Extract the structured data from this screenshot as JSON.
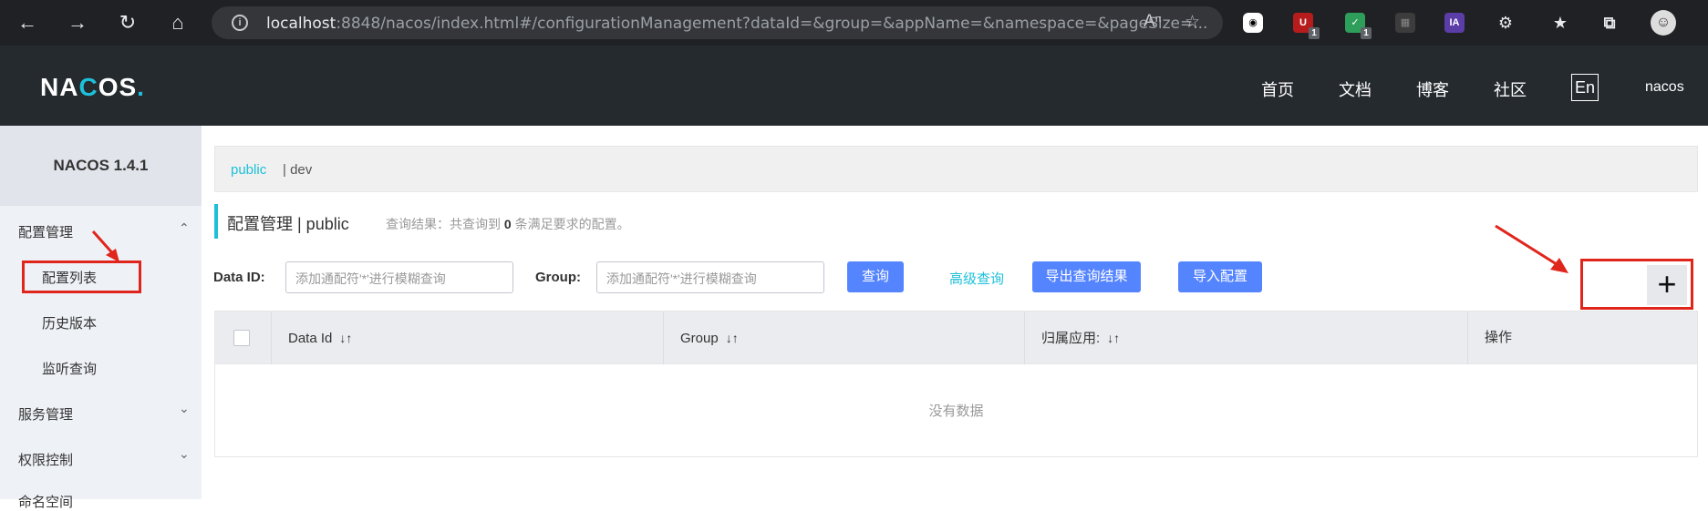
{
  "browser": {
    "url_host": "localhost",
    "url_rest": ":8848/nacos/index.html#/configurationManagement?dataId=&group=&appName=&namespace=&pageSize=...",
    "ext_labels": [
      "1",
      "1",
      "IA"
    ]
  },
  "header": {
    "logo_prefix": "NA",
    "logo_accent": "C",
    "logo_suffix": "OS",
    "logo_dot": ".",
    "nav": [
      "首页",
      "文档",
      "博客",
      "社区"
    ],
    "lang": "En",
    "user": "nacos"
  },
  "sidebar": {
    "version": "NACOS 1.4.1",
    "groups": [
      {
        "label": "配置管理",
        "items": [
          "配置列表",
          "历史版本",
          "监听查询"
        ]
      },
      {
        "label": "服务管理"
      },
      {
        "label": "权限控制"
      },
      {
        "label": "命名空间"
      }
    ]
  },
  "namespaces": {
    "active": "public",
    "other": "| dev"
  },
  "main": {
    "title": "配置管理  |  public",
    "query_prefix": "查询结果：共查询到",
    "query_count": "0",
    "query_suffix": "条满足要求的配置。"
  },
  "search": {
    "dataid_label": "Data ID:",
    "dataid_placeholder": "添加通配符'*'进行模糊查询",
    "group_label": "Group:",
    "group_placeholder": "添加通配符'*'进行模糊查询",
    "query_btn": "查询",
    "advanced_link": "高级查询",
    "export_btn": "导出查询结果",
    "import_btn": "导入配置",
    "add_btn": "+"
  },
  "table": {
    "columns": [
      "Data Id",
      "Group",
      "归属应用:",
      "操作"
    ],
    "empty": "没有数据"
  },
  "colors": {
    "accent": "#1ec0d9",
    "primary": "#5584ff",
    "annotation": "#e0251c"
  }
}
